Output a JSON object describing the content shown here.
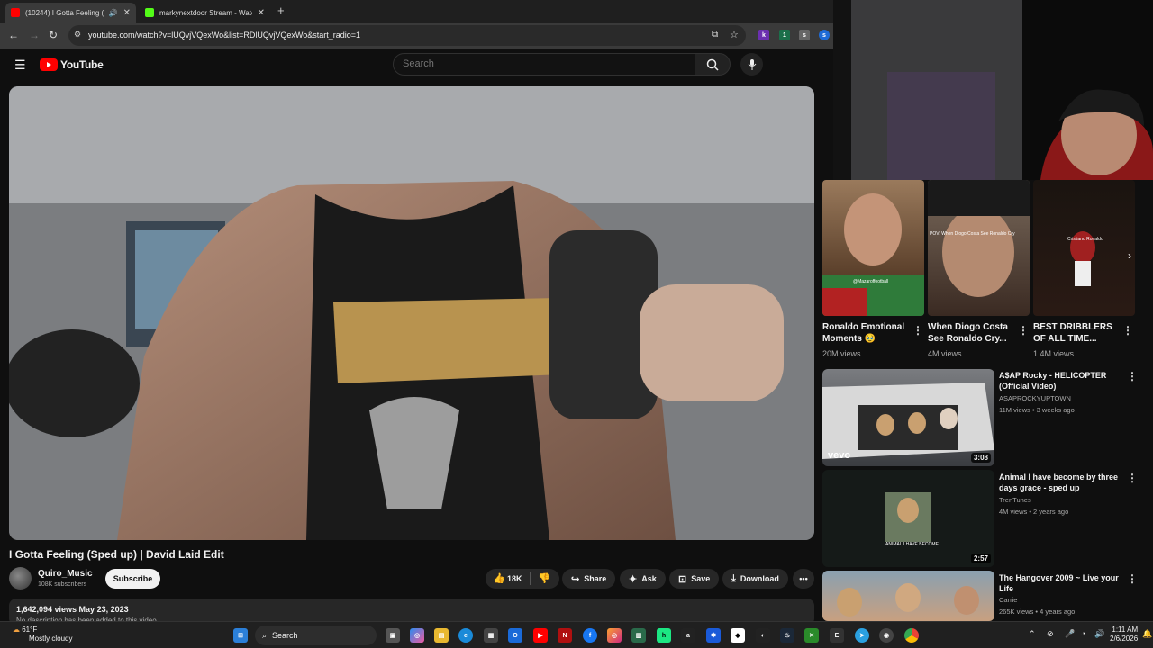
{
  "browser": {
    "tabs": [
      {
        "label": "(10244) I Gotta Feeling (Sp…",
        "active": true
      },
      {
        "label": "markynextdoor Stream - Watch",
        "active": false
      }
    ],
    "url": "youtube.com/watch?v=lUQvjVQexWo&list=RDlUQvjVQexWo&start_radio=1"
  },
  "youtube": {
    "logo": "YouTube",
    "search_placeholder": "Search"
  },
  "video": {
    "title": "I Gotta Feeling (Sped up) | David Laid Edit",
    "channel": "Quiro_Music",
    "subscribers": "108K subscribers",
    "subscribe_label": "Subscribe",
    "likes": "18K",
    "share_label": "Share",
    "ask_label": "Ask",
    "save_label": "Save",
    "download_label": "Download",
    "views_date": "1,642,094 views  May 23, 2023",
    "description": "No description has been added to this video."
  },
  "shorts": [
    {
      "title": "Ronaldo Emotional Moments 🥹",
      "views": "20M views",
      "overlay": "@Mazaroffootball"
    },
    {
      "title": "When Diogo Costa See Ronaldo Cry...",
      "views": "4M views",
      "overlay": "POV: When Diogo Costa See Ronaldo Cry"
    },
    {
      "title": "BEST DRIBBLERS OF ALL TIME...",
      "views": "1.4M views",
      "overlay": "Cristiano Ronaldo"
    }
  ],
  "recommendations": [
    {
      "title": "A$AP Rocky - HELICOPTER (Official Video)",
      "channel": "ASAPROCKYUPTOWN",
      "meta": "11M views • 3 weeks ago",
      "duration": "3:08",
      "overlay": "vevo"
    },
    {
      "title": "Animal I have become by three days grace - sped up",
      "channel": "TrenTunes",
      "meta": "4M views • 2 years ago",
      "duration": "2:57",
      "overlay": "ANIMAL I HAVE BECOME"
    },
    {
      "title": "The Hangover 2009 ~ Live your Life",
      "channel": "Carrie",
      "meta": "265K views • 4 years ago",
      "duration": "",
      "overlay": ""
    }
  ],
  "taskbar": {
    "weather_temp": "61°F",
    "weather_desc": "Mostly cloudy",
    "search_label": "Search",
    "time": "1:11 AM",
    "date": "2/6/2026"
  },
  "colors": {
    "brand_red": "#ff0000",
    "bg": "#0f0f0f",
    "pill": "#272727"
  }
}
